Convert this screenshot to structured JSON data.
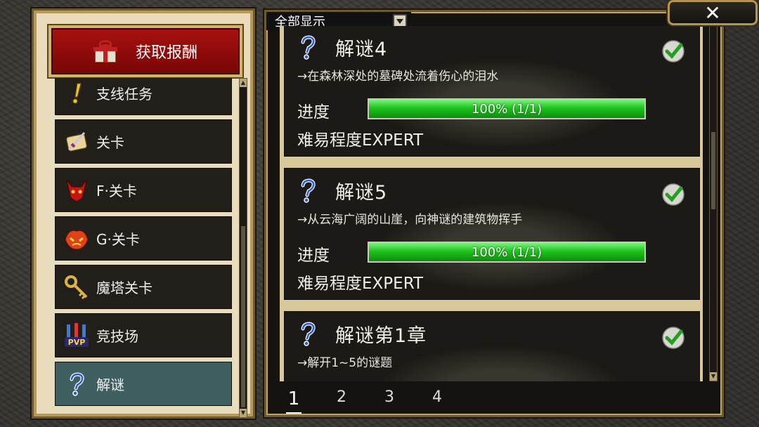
{
  "left_panel": {
    "reward_button_label": "获取报酬",
    "menu_items": [
      {
        "label": "支线任务",
        "icon": "exclamation-icon"
      },
      {
        "label": "关卡",
        "icon": "scroll-sword-icon"
      },
      {
        "label": "F·关卡",
        "icon": "red-demon-icon"
      },
      {
        "label": "G·关卡",
        "icon": "fire-demon-icon"
      },
      {
        "label": "魔塔关卡",
        "icon": "key-icon"
      },
      {
        "label": "竞技场",
        "icon": "pvp-icon"
      },
      {
        "label": "解谜",
        "icon": "question-icon",
        "active": true
      }
    ]
  },
  "right_panel": {
    "filter_label": "全部显示",
    "quests": [
      {
        "title": "解谜4",
        "description": "→在森林深处的墓碑处流着伤心的泪水",
        "progress_label": "进度",
        "progress_text": "100% (1/1)",
        "progress": 1.0,
        "difficulty": "难易程度EXPERT",
        "completed": true
      },
      {
        "title": "解谜5",
        "description": "→从云海广阔的山崖，向神谜的建筑物挥手",
        "progress_label": "进度",
        "progress_text": "100% (1/1)",
        "progress": 1.0,
        "difficulty": "难易程度EXPERT",
        "completed": true
      },
      {
        "title": "解谜第1章",
        "description": "→解开1~5的谜题",
        "completed": true
      }
    ],
    "pages": [
      "1",
      "2",
      "3",
      "4"
    ],
    "current_page": "1"
  },
  "close_button_label": "✕",
  "colors": {
    "accent_red": "#a81010",
    "progress_green": "#1fc31f",
    "active_menu": "#3f5f60",
    "frame_gold": "#c3a45f"
  }
}
